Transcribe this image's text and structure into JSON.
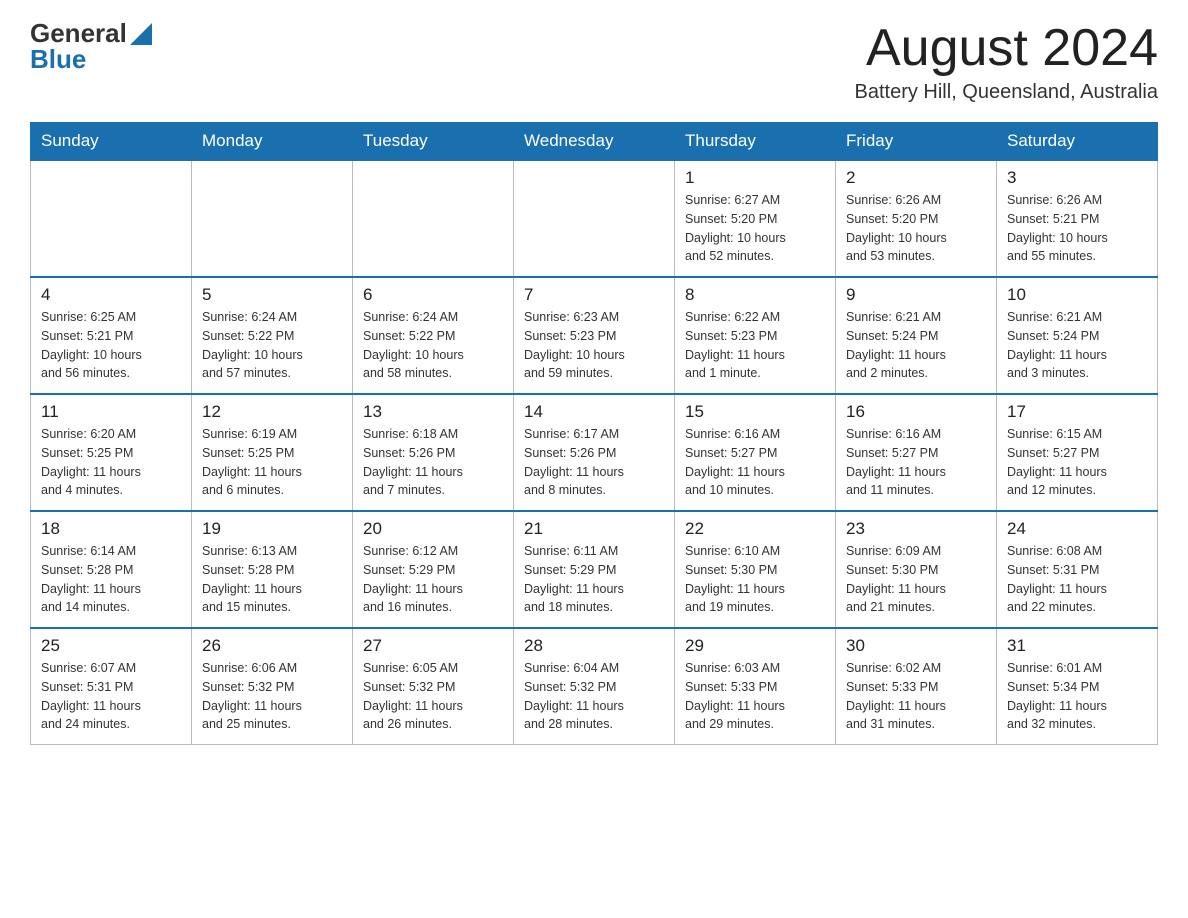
{
  "header": {
    "logo_general": "General",
    "logo_blue": "Blue",
    "month_title": "August 2024",
    "location": "Battery Hill, Queensland, Australia"
  },
  "days_of_week": [
    "Sunday",
    "Monday",
    "Tuesday",
    "Wednesday",
    "Thursday",
    "Friday",
    "Saturday"
  ],
  "weeks": [
    {
      "days": [
        {
          "number": "",
          "info": ""
        },
        {
          "number": "",
          "info": ""
        },
        {
          "number": "",
          "info": ""
        },
        {
          "number": "",
          "info": ""
        },
        {
          "number": "1",
          "info": "Sunrise: 6:27 AM\nSunset: 5:20 PM\nDaylight: 10 hours\nand 52 minutes."
        },
        {
          "number": "2",
          "info": "Sunrise: 6:26 AM\nSunset: 5:20 PM\nDaylight: 10 hours\nand 53 minutes."
        },
        {
          "number": "3",
          "info": "Sunrise: 6:26 AM\nSunset: 5:21 PM\nDaylight: 10 hours\nand 55 minutes."
        }
      ]
    },
    {
      "days": [
        {
          "number": "4",
          "info": "Sunrise: 6:25 AM\nSunset: 5:21 PM\nDaylight: 10 hours\nand 56 minutes."
        },
        {
          "number": "5",
          "info": "Sunrise: 6:24 AM\nSunset: 5:22 PM\nDaylight: 10 hours\nand 57 minutes."
        },
        {
          "number": "6",
          "info": "Sunrise: 6:24 AM\nSunset: 5:22 PM\nDaylight: 10 hours\nand 58 minutes."
        },
        {
          "number": "7",
          "info": "Sunrise: 6:23 AM\nSunset: 5:23 PM\nDaylight: 10 hours\nand 59 minutes."
        },
        {
          "number": "8",
          "info": "Sunrise: 6:22 AM\nSunset: 5:23 PM\nDaylight: 11 hours\nand 1 minute."
        },
        {
          "number": "9",
          "info": "Sunrise: 6:21 AM\nSunset: 5:24 PM\nDaylight: 11 hours\nand 2 minutes."
        },
        {
          "number": "10",
          "info": "Sunrise: 6:21 AM\nSunset: 5:24 PM\nDaylight: 11 hours\nand 3 minutes."
        }
      ]
    },
    {
      "days": [
        {
          "number": "11",
          "info": "Sunrise: 6:20 AM\nSunset: 5:25 PM\nDaylight: 11 hours\nand 4 minutes."
        },
        {
          "number": "12",
          "info": "Sunrise: 6:19 AM\nSunset: 5:25 PM\nDaylight: 11 hours\nand 6 minutes."
        },
        {
          "number": "13",
          "info": "Sunrise: 6:18 AM\nSunset: 5:26 PM\nDaylight: 11 hours\nand 7 minutes."
        },
        {
          "number": "14",
          "info": "Sunrise: 6:17 AM\nSunset: 5:26 PM\nDaylight: 11 hours\nand 8 minutes."
        },
        {
          "number": "15",
          "info": "Sunrise: 6:16 AM\nSunset: 5:27 PM\nDaylight: 11 hours\nand 10 minutes."
        },
        {
          "number": "16",
          "info": "Sunrise: 6:16 AM\nSunset: 5:27 PM\nDaylight: 11 hours\nand 11 minutes."
        },
        {
          "number": "17",
          "info": "Sunrise: 6:15 AM\nSunset: 5:27 PM\nDaylight: 11 hours\nand 12 minutes."
        }
      ]
    },
    {
      "days": [
        {
          "number": "18",
          "info": "Sunrise: 6:14 AM\nSunset: 5:28 PM\nDaylight: 11 hours\nand 14 minutes."
        },
        {
          "number": "19",
          "info": "Sunrise: 6:13 AM\nSunset: 5:28 PM\nDaylight: 11 hours\nand 15 minutes."
        },
        {
          "number": "20",
          "info": "Sunrise: 6:12 AM\nSunset: 5:29 PM\nDaylight: 11 hours\nand 16 minutes."
        },
        {
          "number": "21",
          "info": "Sunrise: 6:11 AM\nSunset: 5:29 PM\nDaylight: 11 hours\nand 18 minutes."
        },
        {
          "number": "22",
          "info": "Sunrise: 6:10 AM\nSunset: 5:30 PM\nDaylight: 11 hours\nand 19 minutes."
        },
        {
          "number": "23",
          "info": "Sunrise: 6:09 AM\nSunset: 5:30 PM\nDaylight: 11 hours\nand 21 minutes."
        },
        {
          "number": "24",
          "info": "Sunrise: 6:08 AM\nSunset: 5:31 PM\nDaylight: 11 hours\nand 22 minutes."
        }
      ]
    },
    {
      "days": [
        {
          "number": "25",
          "info": "Sunrise: 6:07 AM\nSunset: 5:31 PM\nDaylight: 11 hours\nand 24 minutes."
        },
        {
          "number": "26",
          "info": "Sunrise: 6:06 AM\nSunset: 5:32 PM\nDaylight: 11 hours\nand 25 minutes."
        },
        {
          "number": "27",
          "info": "Sunrise: 6:05 AM\nSunset: 5:32 PM\nDaylight: 11 hours\nand 26 minutes."
        },
        {
          "number": "28",
          "info": "Sunrise: 6:04 AM\nSunset: 5:32 PM\nDaylight: 11 hours\nand 28 minutes."
        },
        {
          "number": "29",
          "info": "Sunrise: 6:03 AM\nSunset: 5:33 PM\nDaylight: 11 hours\nand 29 minutes."
        },
        {
          "number": "30",
          "info": "Sunrise: 6:02 AM\nSunset: 5:33 PM\nDaylight: 11 hours\nand 31 minutes."
        },
        {
          "number": "31",
          "info": "Sunrise: 6:01 AM\nSunset: 5:34 PM\nDaylight: 11 hours\nand 32 minutes."
        }
      ]
    }
  ]
}
